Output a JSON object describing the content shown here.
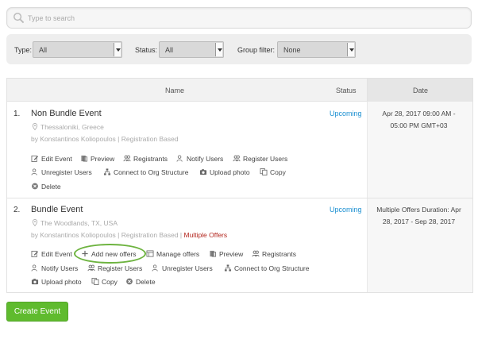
{
  "search": {
    "placeholder": "Type to search"
  },
  "filters": {
    "type_label": "Type:",
    "type_value": "All",
    "status_label": "Status:",
    "status_value": "All",
    "group_label": "Group filter:",
    "group_value": "None"
  },
  "table": {
    "col_name": "Name",
    "col_status": "Status",
    "col_date": "Date"
  },
  "events": [
    {
      "num": "1.",
      "title": "Non Bundle Event",
      "location": "Thessaloniki, Greece",
      "by": "by Konstantinos Koliopoulos",
      "sep": " | ",
      "type": "Registration Based",
      "status": "Upcoming",
      "date_line1": "Apr 28, 2017 09:00 AM -",
      "date_line2": "05:00 PM GMT+03",
      "actions": {
        "edit": "Edit Event",
        "preview": "Preview",
        "registrants": "Registrants",
        "notify": "Notify Users",
        "register": "Register Users",
        "unregister": "Unregister Users",
        "connect": "Connect to Org Structure",
        "upload": "Upload photo",
        "copy": "Copy",
        "delete": "Delete"
      }
    },
    {
      "num": "2.",
      "title": "Bundle Event",
      "location": "The Woodlands, TX, USA",
      "by": "by Konstantinos Koliopoulos",
      "sep": " | ",
      "type": "Registration Based",
      "sep2": " | ",
      "extra": "Multiple Offers",
      "status": "Upcoming",
      "date_line1": "Multiple Offers Duration: Apr",
      "date_line2": "28, 2017 - Sep 28, 2017",
      "actions": {
        "edit": "Edit Event",
        "add_offers": "Add new offers",
        "manage": "Manage offers",
        "preview": "Preview",
        "registrants": "Registrants",
        "notify": "Notify Users",
        "register": "Register Users",
        "unregister": "Unregister Users",
        "connect": "Connect to Org Structure",
        "upload": "Upload photo",
        "copy": "Copy",
        "delete": "Delete"
      }
    }
  ],
  "create_button": "Create Event",
  "colors": {
    "accent_green": "#5fbb2e",
    "link_blue": "#1a8fd1",
    "warning_red": "#b3261e"
  }
}
